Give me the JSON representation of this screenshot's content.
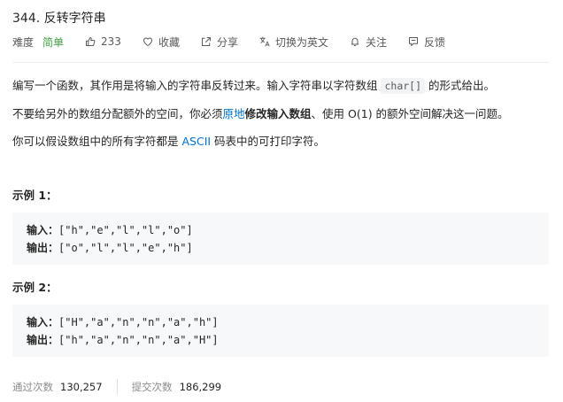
{
  "problem": {
    "title": "344. 反转字符串"
  },
  "meta": {
    "difficulty_label": "难度",
    "difficulty_value": "简单",
    "likes": "233",
    "favorite": "收藏",
    "share": "分享",
    "switch_lang": "切换为英文",
    "follow": "关注",
    "feedback": "反馈"
  },
  "description": {
    "p1_before": "编写一个函数，其作用是将输入的字符串反转过来。输入字符串以字符数组 ",
    "p1_code": "char[]",
    "p1_after": " 的形式给出。",
    "p2_a": "不要给另外的数组分配额外的空间，你必须",
    "p2_link": "原地",
    "p2_bold": "修改输入数组",
    "p2_b": "、使用 O(1) 的额外空间解决这一问题。",
    "p3_a": "你可以假设数组中的所有字符都是 ",
    "p3_link": "ASCII",
    "p3_b": " 码表中的可打印字符。"
  },
  "examples": [
    {
      "title": "示例 1：",
      "input_label": "输入：",
      "input": "[\"h\",\"e\",\"l\",\"l\",\"o\"]",
      "output_label": "输出：",
      "output": "[\"o\",\"l\",\"l\",\"e\",\"h\"]"
    },
    {
      "title": "示例 2：",
      "input_label": "输入：",
      "input": "[\"H\",\"a\",\"n\",\"n\",\"a\",\"h\"]",
      "output_label": "输出：",
      "output": "[\"h\",\"a\",\"n\",\"n\",\"a\",\"H\"]"
    }
  ],
  "stats": {
    "accepted_label": "通过次数",
    "accepted_value": "130,257",
    "submissions_label": "提交次数",
    "submissions_value": "186,299"
  },
  "colors": {
    "easy": "#43a047",
    "link": "#0073d1",
    "example_bg": "#f7f8fa"
  }
}
